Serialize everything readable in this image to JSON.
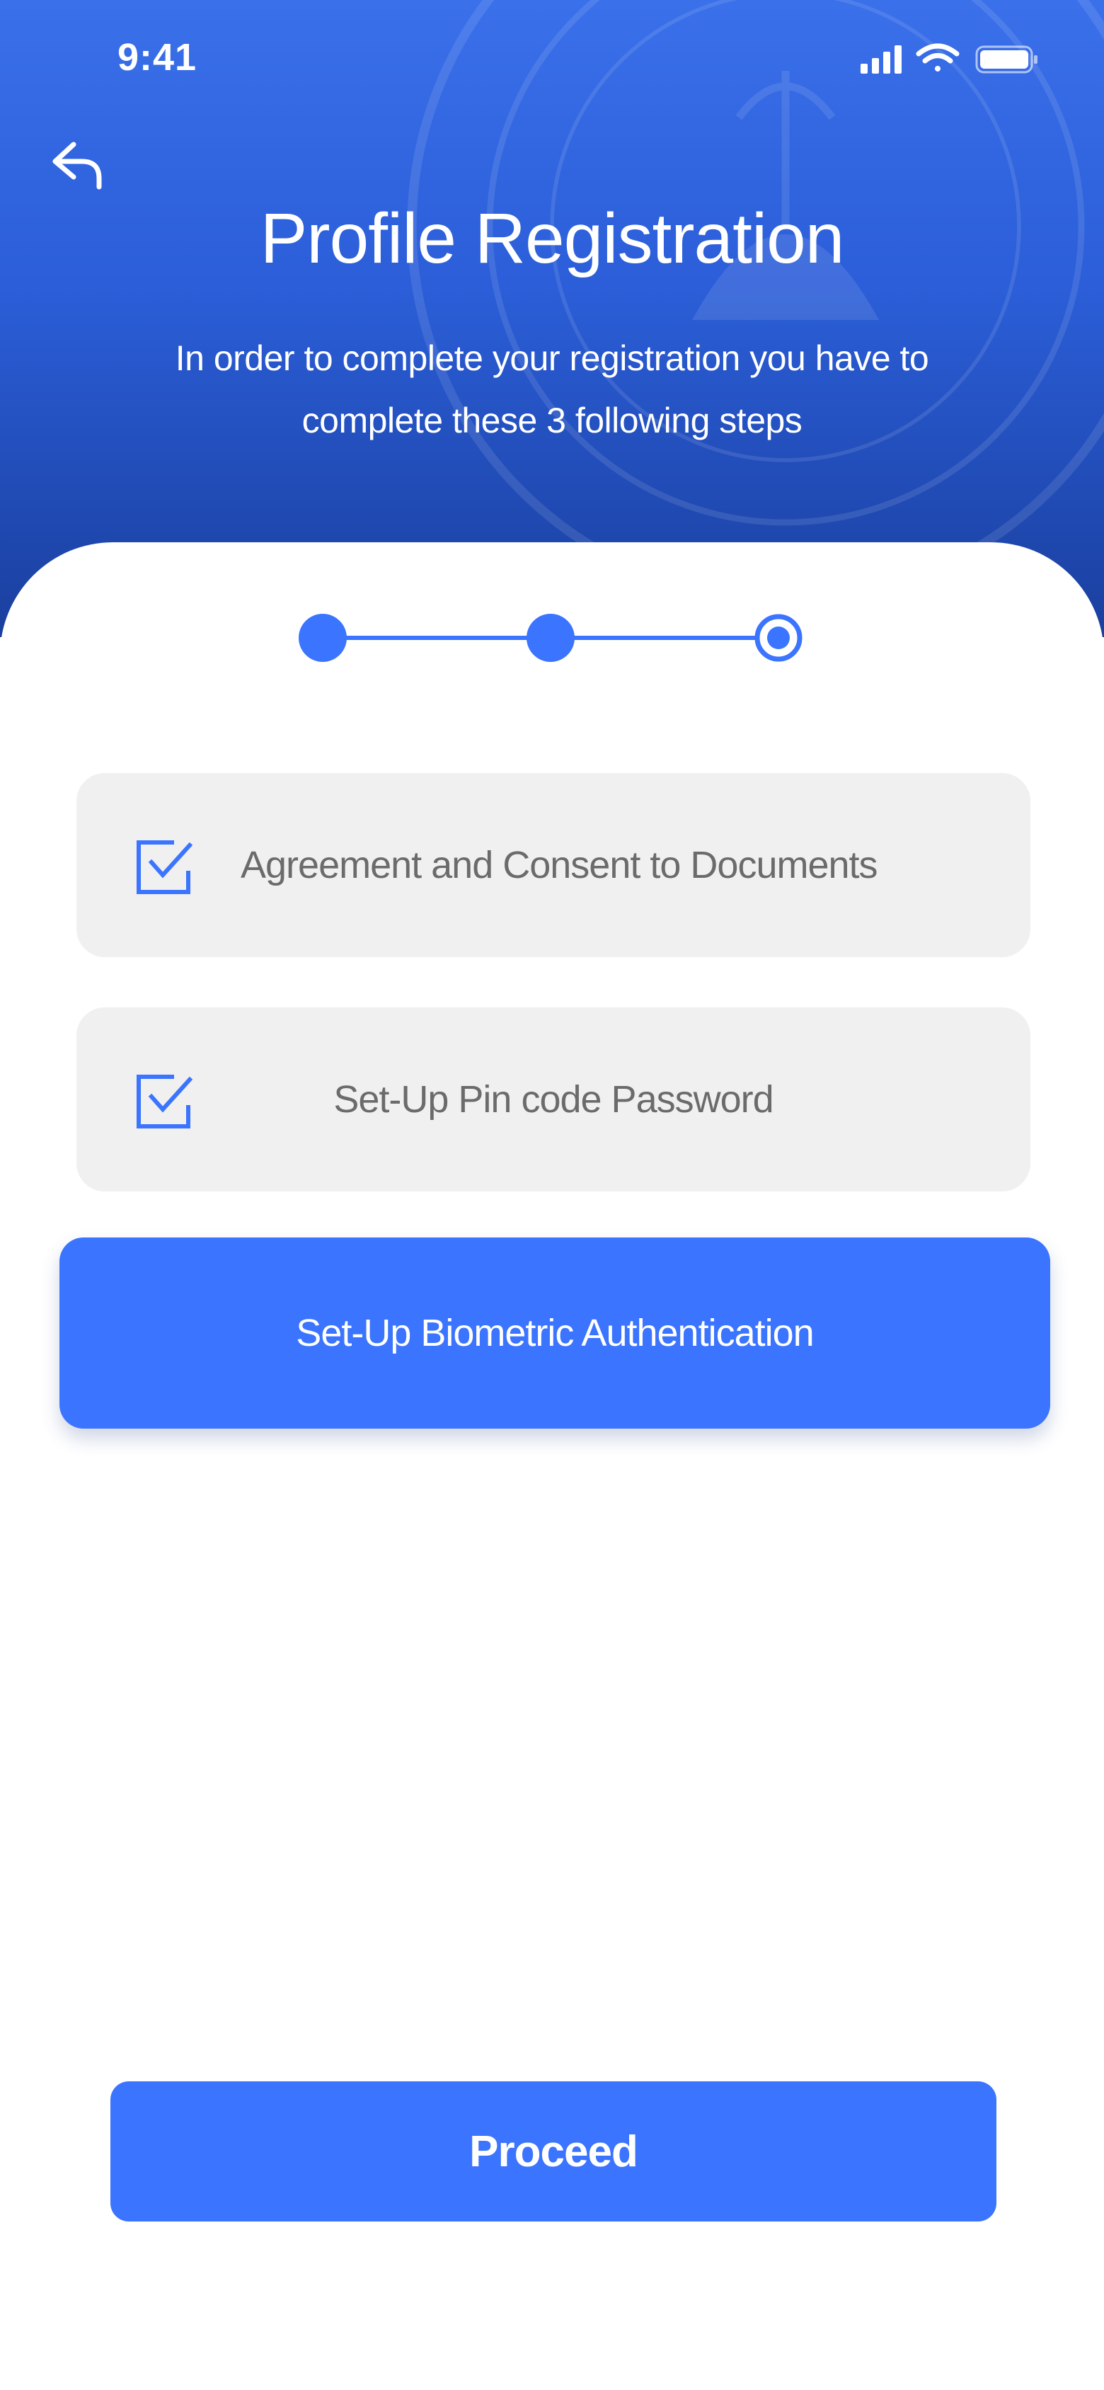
{
  "status_bar": {
    "time": "9:41"
  },
  "header": {
    "title": "Profile Registration",
    "subtitle_line1": "In order to complete your registration you  have to",
    "subtitle_line2": "complete these 3 following steps"
  },
  "stepper": {
    "total_steps": 3,
    "current_step": 3
  },
  "steps": [
    {
      "label": "Agreement and Consent to Documents",
      "completed": true
    },
    {
      "label": "Set-Up Pin code Password",
      "completed": true
    },
    {
      "label": "Set-Up Biometric Authentication",
      "completed": false,
      "active": true
    }
  ],
  "actions": {
    "proceed_label": "Proceed"
  },
  "colors": {
    "primary": "#3B74FF",
    "header_top": "#3A70EA",
    "header_bottom": "#1A3F9E",
    "row_background": "#F0F0F0",
    "row_text": "#6B6B6B"
  },
  "icons": {
    "back": "back-arrow-icon",
    "step_done": "checkbox-checked-icon",
    "signal": "cellular-signal-icon",
    "wifi": "wifi-icon",
    "battery": "battery-icon"
  }
}
